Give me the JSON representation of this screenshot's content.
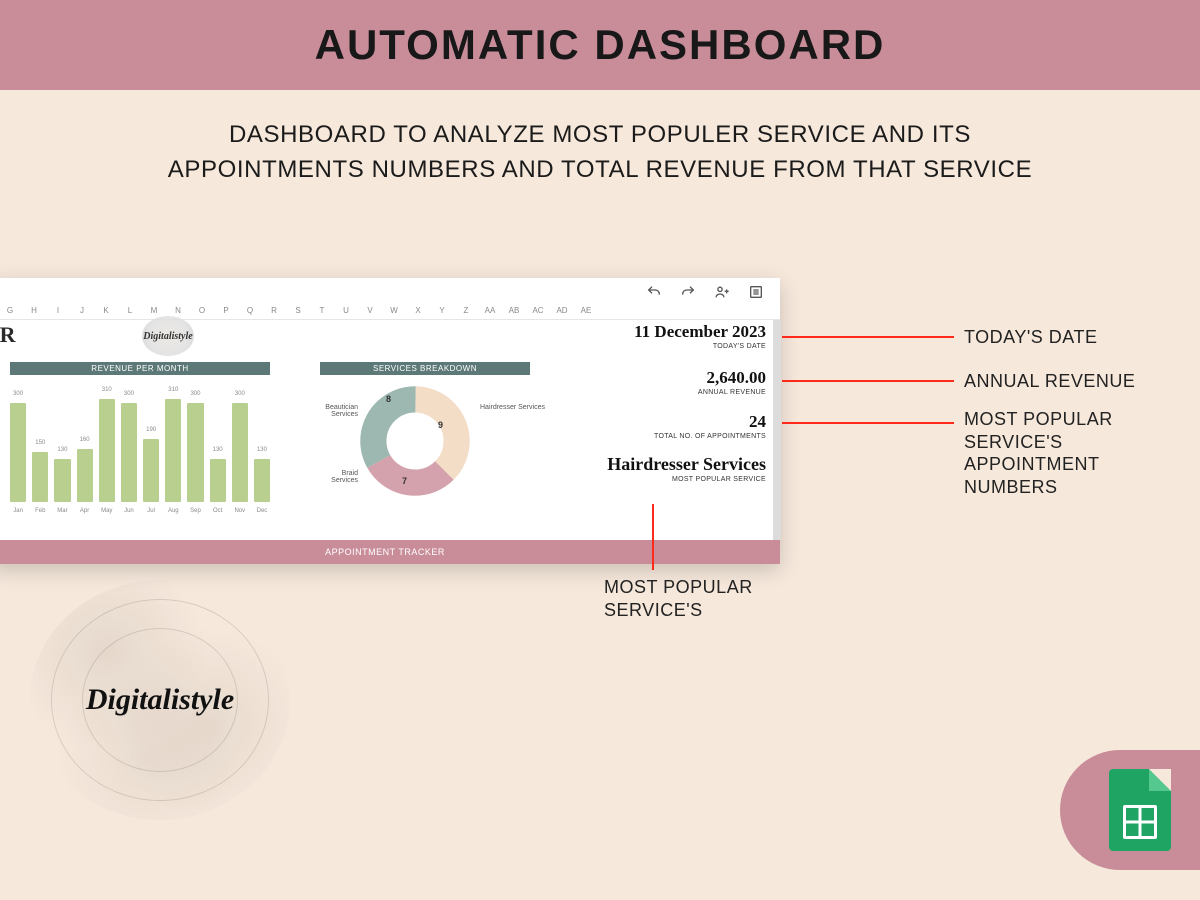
{
  "hero": {
    "title": "AUTOMATIC DASHBOARD"
  },
  "subhead": "DASHBOARD TO ANALYZE MOST POPULER SERVICE AND ITS APPOINTMENTS NUMBERS AND TOTAL REVENUE FROM THAT SERVICE",
  "sheet": {
    "columns": [
      "G",
      "H",
      "I",
      "J",
      "K",
      "L",
      "M",
      "N",
      "O",
      "P",
      "Q",
      "R",
      "S",
      "T",
      "U",
      "V",
      "W",
      "X",
      "Y",
      "Z",
      "AA",
      "AB",
      "AC",
      "AD",
      "AE"
    ],
    "tracker_title_fragment": "ER",
    "brand_mini": "Digitalistyle",
    "bar_title": "REVENUE PER MONTH",
    "pie_title": "SERVICES BREAKDOWN",
    "footer": "APPOINTMENT TRACKER",
    "metrics": {
      "date": {
        "value": "11 December 2023",
        "label": "TODAY'S DATE"
      },
      "revenue": {
        "value": "2,640.00",
        "label": "ANNUAL REVENUE"
      },
      "appts": {
        "value": "24",
        "label": "TOTAL NO. OF APPOINTMENTS"
      },
      "popular": {
        "value": "Hairdresser Services",
        "label": "MOST POPULAR SERVICE"
      }
    }
  },
  "callouts": {
    "c1": "TODAY'S DATE",
    "c2": "ANNUAL REVENUE",
    "c3": "MOST POPULAR SERVICE'S APPOINTMENT NUMBERS",
    "c4": "MOST POPULAR SERVICE'S"
  },
  "brand_large": "Digitalistyle",
  "chart_data": [
    {
      "type": "bar",
      "title": "REVENUE PER MONTH",
      "categories": [
        "Jan",
        "Feb",
        "Mar",
        "Apr",
        "May",
        "Jun",
        "Jul",
        "Aug",
        "Sep",
        "Oct",
        "Nov",
        "Dec"
      ],
      "values": [
        300,
        150,
        130,
        160,
        310,
        300,
        190,
        310,
        300,
        130,
        300,
        130
      ],
      "ylim": [
        0,
        350
      ],
      "xlabel": "",
      "ylabel": ""
    },
    {
      "type": "pie",
      "title": "SERVICES BREAKDOWN",
      "series": [
        {
          "name": "Beautician Services",
          "value": 8
        },
        {
          "name": "Hairdresser Services",
          "value": 9
        },
        {
          "name": "Braid Services",
          "value": 7
        }
      ]
    }
  ]
}
